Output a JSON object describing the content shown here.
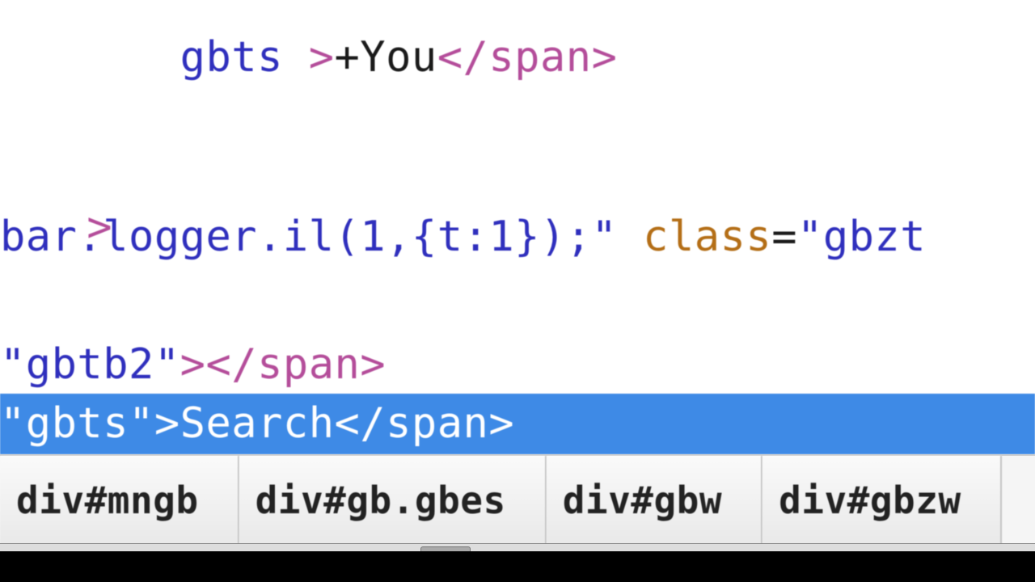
{
  "code": {
    "line1_prefix": "   gbts",
    "line1_close1": ">",
    "line1_close2": "</span>",
    "line2_frag_val": "bar.logger.il(1,{t:1});\"",
    "line2_attr": " class",
    "line2_eq": "=",
    "line2_val2": "\"gbzt",
    "line3_val": "\"gbtb2\"",
    "line3_gt": ">",
    "line3_close": "</span>"
  },
  "selected": {
    "val": "\"gbts\"",
    "gt": ">",
    "text": "Search",
    "close": "</span>"
  },
  "breadcrumbs": [
    "div#mngb",
    "div#gb.gbes",
    "div#gbw",
    "div#gbzw"
  ]
}
